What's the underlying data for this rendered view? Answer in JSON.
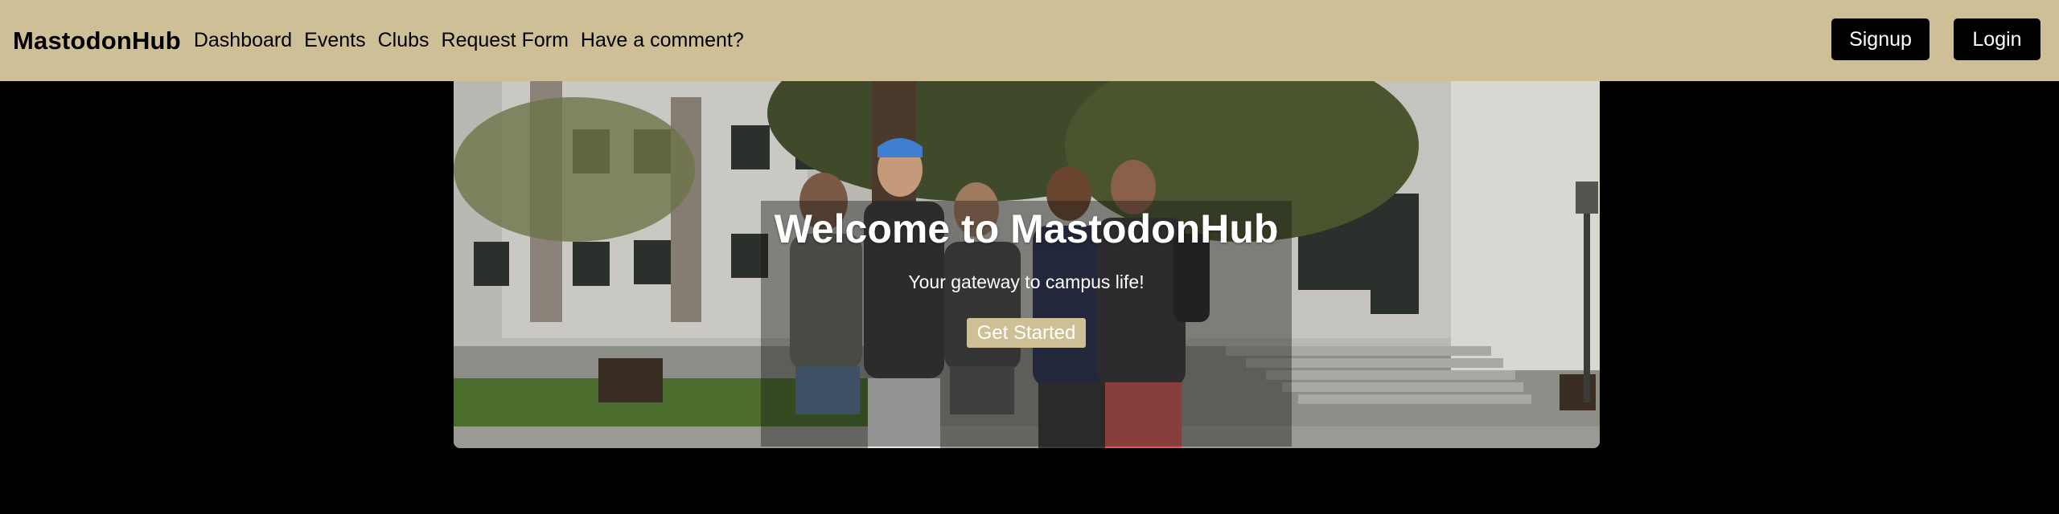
{
  "navbar": {
    "brand": "MastodonHub",
    "links": [
      {
        "label": "Dashboard"
      },
      {
        "label": "Events"
      },
      {
        "label": "Clubs"
      },
      {
        "label": "Request Form"
      },
      {
        "label": "Have a comment?"
      }
    ],
    "signup_label": "Signup",
    "login_label": "Login"
  },
  "hero": {
    "title": "Welcome to MastodonHub",
    "subtitle": "Your gateway to campus life!",
    "cta_label": "Get Started"
  },
  "colors": {
    "navbar_bg": "#cfbf96",
    "page_bg": "#000000",
    "button_bg": "#000000",
    "cta_bg": "#cfbf96"
  }
}
